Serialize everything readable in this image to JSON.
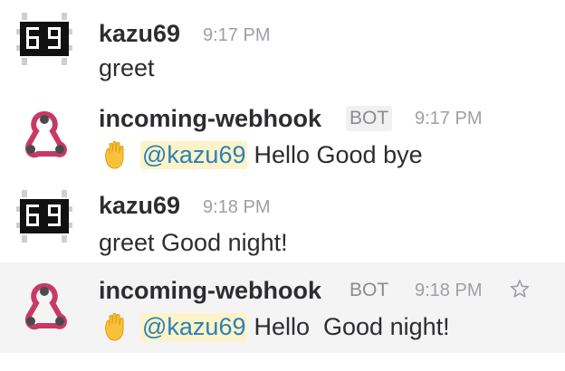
{
  "messages": [
    {
      "author": "kazu69",
      "time": "9:17 PM",
      "text": "greet"
    },
    {
      "author": "incoming-webhook",
      "badge": "BOT",
      "time": "9:17 PM",
      "mention": "@kazu69",
      "text": "Hello Good bye",
      "icon": "raised-hand-emoji"
    },
    {
      "author": "kazu69",
      "time": "9:18 PM",
      "text": "greet Good night!"
    },
    {
      "author": "incoming-webhook",
      "badge": "BOT",
      "time": "9:18 PM",
      "mention": "@kazu69",
      "text": "Hello  Good night!",
      "icon": "raised-hand-emoji"
    }
  ],
  "colors": {
    "mention_text": "#2a80b9",
    "mention_bg": "#fdf3c8",
    "webhook_logo": "#c73a63",
    "hover_bg": "#f4f4f4"
  }
}
